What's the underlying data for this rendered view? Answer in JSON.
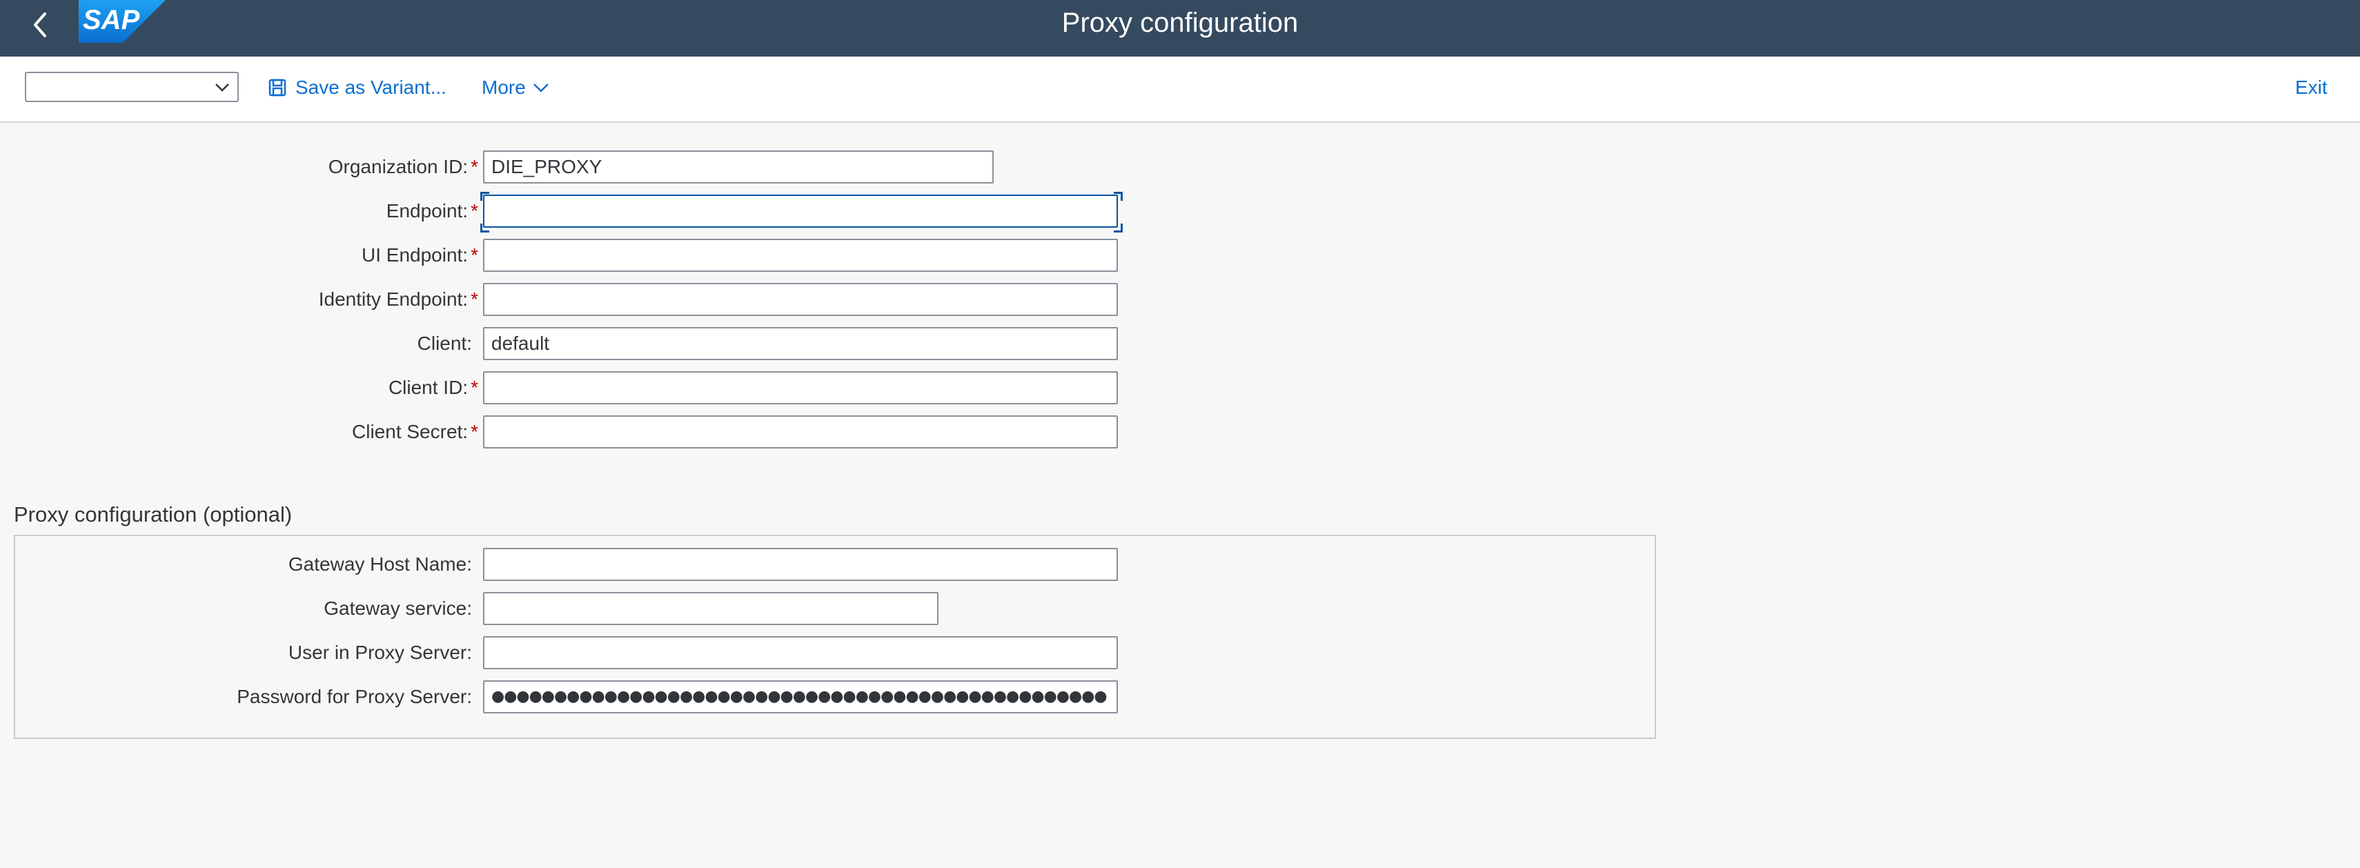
{
  "shell": {
    "title": "Proxy configuration",
    "logo_text": "SAP",
    "brand_colors": {
      "header_bg": "#354a5f",
      "logo_blue": "#0a6ed1",
      "accent": "#0a6ed1",
      "required": "#bb0000"
    }
  },
  "toolbar": {
    "variant_value": "",
    "save_variant_label": "Save as Variant...",
    "more_label": "More",
    "exit_label": "Exit"
  },
  "form": {
    "fields": [
      {
        "label": "Organization ID:",
        "required": true,
        "value": "DIE_PROXY"
      },
      {
        "label": "Endpoint:",
        "required": true,
        "value": "",
        "focused": true
      },
      {
        "label": "UI Endpoint:",
        "required": true,
        "value": ""
      },
      {
        "label": "Identity Endpoint:",
        "required": true,
        "value": ""
      },
      {
        "label": "Client:",
        "required": false,
        "value": "default"
      },
      {
        "label": "Client ID:",
        "required": true,
        "value": ""
      },
      {
        "label": "Client Secret:",
        "required": true,
        "value": ""
      }
    ],
    "required_marker": "*"
  },
  "proxy_section": {
    "title": "Proxy configuration (optional)",
    "fields": [
      {
        "label": "Gateway Host Name:",
        "value": ""
      },
      {
        "label": "Gateway service:",
        "value": ""
      },
      {
        "label": "User in Proxy Server:",
        "value": ""
      },
      {
        "label": "Password for Proxy Server:",
        "value": "●●●●●●●●●●●●●●●●●●●●●●●●●●●●●●●●●●●●●●●●●●●●●●●●●"
      }
    ]
  }
}
